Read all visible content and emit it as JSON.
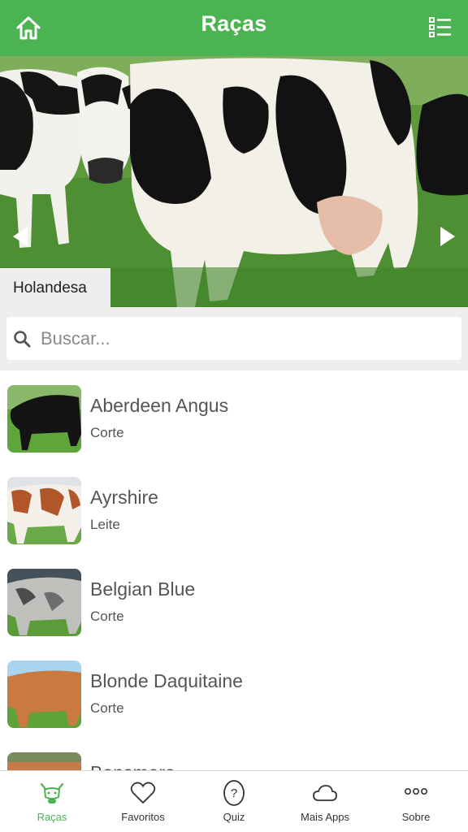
{
  "header": {
    "title": "Raças",
    "home_icon": "home-icon",
    "list_icon": "list-icon",
    "color": "#4bb352"
  },
  "hero": {
    "caption": "Holandesa",
    "prev_icon": "chevron-left-icon",
    "next_icon": "chevron-right-icon"
  },
  "search": {
    "placeholder": "Buscar...",
    "value": ""
  },
  "breeds": [
    {
      "name": "Aberdeen Angus",
      "type": "Corte"
    },
    {
      "name": "Ayrshire",
      "type": "Leite"
    },
    {
      "name": "Belgian Blue",
      "type": "Corte"
    },
    {
      "name": "Blonde Daquitaine",
      "type": "Corte"
    },
    {
      "name": "Bonsmara",
      "type": ""
    }
  ],
  "tabs": [
    {
      "label": "Raças",
      "icon": "cow-icon",
      "active": true
    },
    {
      "label": "Favoritos",
      "icon": "heart-icon",
      "active": false
    },
    {
      "label": "Quiz",
      "icon": "question-icon",
      "active": false
    },
    {
      "label": "Mais Apps",
      "icon": "cloud-icon",
      "active": false
    },
    {
      "label": "Sobre",
      "icon": "more-icon",
      "active": false
    }
  ],
  "colors": {
    "accent": "#4bb352",
    "tab_active": "#4bb352",
    "tab_inactive": "#333333"
  }
}
